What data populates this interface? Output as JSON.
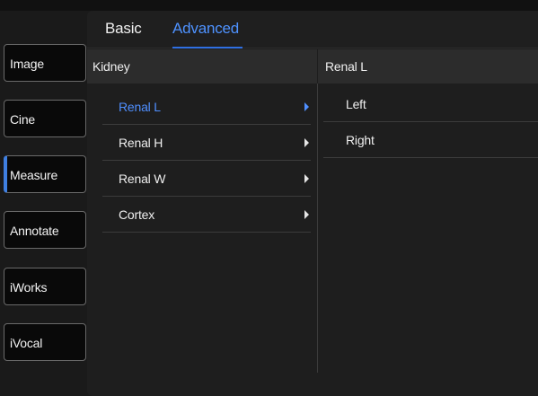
{
  "sidebar": {
    "items": [
      {
        "label": "Image",
        "active": false
      },
      {
        "label": "Cine",
        "active": false
      },
      {
        "label": "Measure",
        "active": true
      },
      {
        "label": "Annotate",
        "active": false
      },
      {
        "label": "iWorks",
        "active": false
      },
      {
        "label": "iVocal",
        "active": false
      }
    ]
  },
  "tabs": {
    "basic": "Basic",
    "advanced": "Advanced",
    "selected": "Advanced"
  },
  "left_panel": {
    "header": "Kidney",
    "items": [
      {
        "label": "Renal L",
        "selected": true
      },
      {
        "label": "Renal H",
        "selected": false
      },
      {
        "label": "Renal W",
        "selected": false
      },
      {
        "label": "Cortex",
        "selected": false
      }
    ],
    "icons": [
      "chevron-right-icon",
      "chevron-right-icon",
      "chevron-right-icon",
      "chevron-right-icon"
    ]
  },
  "right_panel": {
    "header": "Renal L",
    "items": [
      {
        "label": "Left"
      },
      {
        "label": "Right"
      }
    ]
  },
  "colors": {
    "accent": "#4f8fff",
    "background": "#1e1e1e",
    "header": "#2c2c2c",
    "text": "#efefef"
  }
}
